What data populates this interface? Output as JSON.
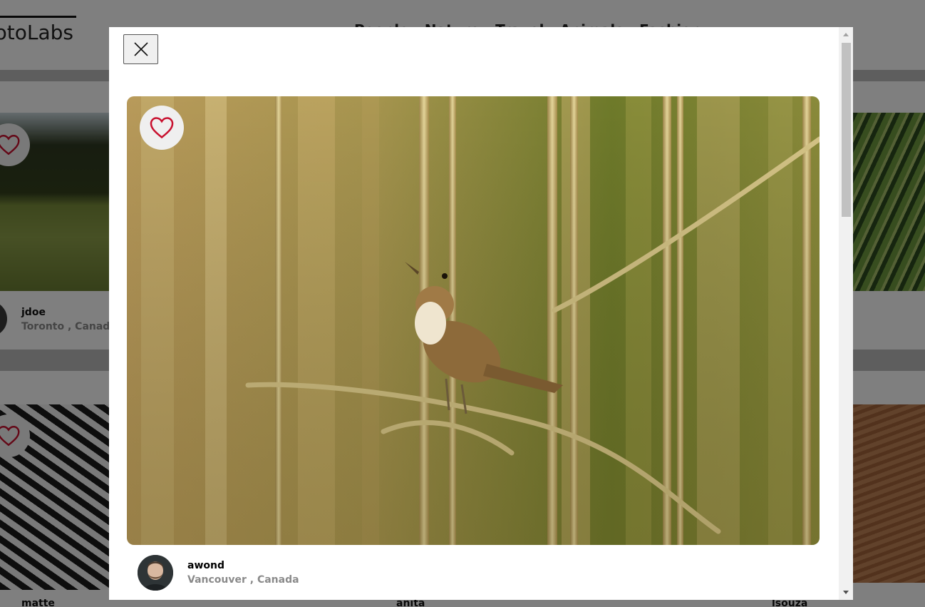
{
  "app": {
    "logo_text": "PhotoLabs",
    "topics": [
      "People",
      "Nature",
      "Travel",
      "Animals",
      "Fashion"
    ]
  },
  "background_cards": [
    {
      "username": "jdoe",
      "location": "Toronto , Canada"
    },
    {
      "username": "matte",
      "location": ""
    },
    {
      "username": "anita",
      "location": ""
    },
    {
      "username": "lsouza",
      "location": ""
    }
  ],
  "modal": {
    "close_icon": "close-icon",
    "favourite_icon": "heart-outline-icon",
    "photo": {
      "subject": "bird-in-reeds",
      "author": {
        "username": "awond",
        "location": "Vancouver , Canada"
      }
    }
  },
  "colors": {
    "heart_outline": "#c8102e",
    "overlay": "rgba(0,0,0,0.5)",
    "location_text": "#8a8a8a"
  }
}
